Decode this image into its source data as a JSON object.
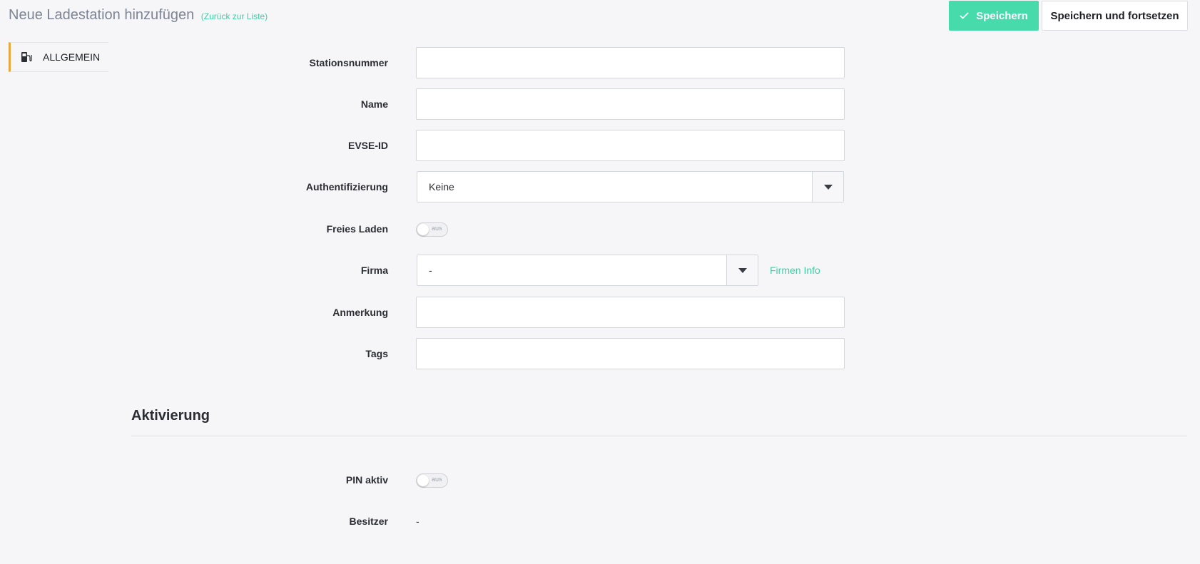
{
  "header": {
    "title": "Neue Ladestation hinzufügen",
    "back_link": "(Zurück zur Liste)",
    "save_label": "Speichern",
    "save_continue_label": "Speichern und fortsetzen"
  },
  "sidebar": {
    "tabs": [
      {
        "label": "ALLGEMEIN",
        "icon": "charging-station-icon",
        "active": true
      }
    ],
    "active_color": "#e8a93a"
  },
  "form": {
    "station_number": {
      "label": "Stationsnummer",
      "value": ""
    },
    "name": {
      "label": "Name",
      "value": ""
    },
    "evse_id": {
      "label": "EVSE-ID",
      "value": ""
    },
    "authentication": {
      "label": "Authentifizierung",
      "selected": "Keine"
    },
    "free_charging": {
      "label": "Freies Laden",
      "state": "aus"
    },
    "company": {
      "label": "Firma",
      "selected": "-",
      "info_link": "Firmen Info"
    },
    "remark": {
      "label": "Anmerkung",
      "value": ""
    },
    "tags": {
      "label": "Tags",
      "value": ""
    }
  },
  "activation": {
    "title": "Aktivierung",
    "pin_active": {
      "label": "PIN aktiv",
      "state": "aus"
    },
    "owner": {
      "label": "Besitzer",
      "value": "-"
    }
  },
  "colors": {
    "accent": "#47dbac",
    "link": "#3ccfa4",
    "background": "#f6f6f9"
  }
}
